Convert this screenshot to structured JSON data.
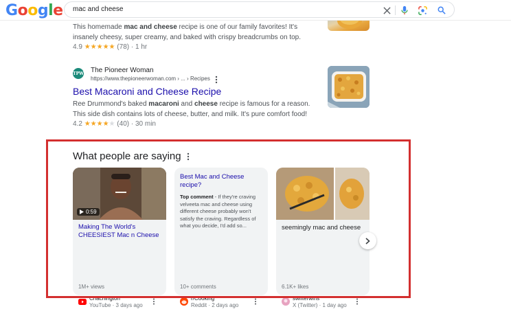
{
  "header": {
    "logo_letters": [
      "G",
      "o",
      "o",
      "g",
      "l",
      "e"
    ],
    "logo_colors": [
      "#4285F4",
      "#EA4335",
      "#FBBC05",
      "#4285F4",
      "#34A853",
      "#EA4335"
    ],
    "query": "mac and cheese"
  },
  "result1": {
    "snippet_start": "This homemade ",
    "snippet_b1": "mac and cheese",
    "snippet_rest": " recipe is one of our family favorites! It's insanely cheesy, super creamy, and baked with crispy breadcrumbs on top.",
    "rating": "4.9",
    "stars": "★★★★★",
    "reviews": "(78)",
    "time": "· 1 hr"
  },
  "result2": {
    "site_icon_text": "TPW",
    "site_name": "The Pioneer Woman",
    "url": "https://www.thepioneerwoman.com › ... › Recipes",
    "title": "Best Macaroni and Cheese Recipe",
    "snippet_start": "Ree Drummond's baked ",
    "snippet_b1": "macaroni",
    "snippet_mid": " and ",
    "snippet_b2": "cheese",
    "snippet_rest": " recipe is famous for a reason. This side dish contains lots of cheese, butter, and milk. It's pure comfort food!",
    "rating": "4.2",
    "stars": "★★★★",
    "star_empty": "★",
    "reviews": "(40)",
    "time": "· 30 min"
  },
  "people": {
    "heading": "What people are saying",
    "cards": [
      {
        "duration": "0:59",
        "title": "Making The World's CHEESIEST Mac n Cheese",
        "footer": "1M+ views",
        "source": "Chachington",
        "meta": "YouTube · 3 days ago"
      },
      {
        "title": "Best Mac and Cheese recipe?",
        "comment_label": "Top comment",
        "comment": " - If they're craving velveeta mac and cheese using different cheese probably won't satisfy the craving. Regardless of what you decide, I'd add so...",
        "footer": "10+ comments",
        "source": "r/Cooking",
        "meta": "Reddit · 2 days ago"
      },
      {
        "title": "seemingly mac and cheese",
        "footer": "6.1K+ likes",
        "source": "swifterwins",
        "meta": "X (Twitter) · 1 day ago"
      }
    ]
  },
  "colors": {
    "link": "#1a0dab",
    "highlight": "#d32f2f",
    "star": "#f5a623"
  }
}
